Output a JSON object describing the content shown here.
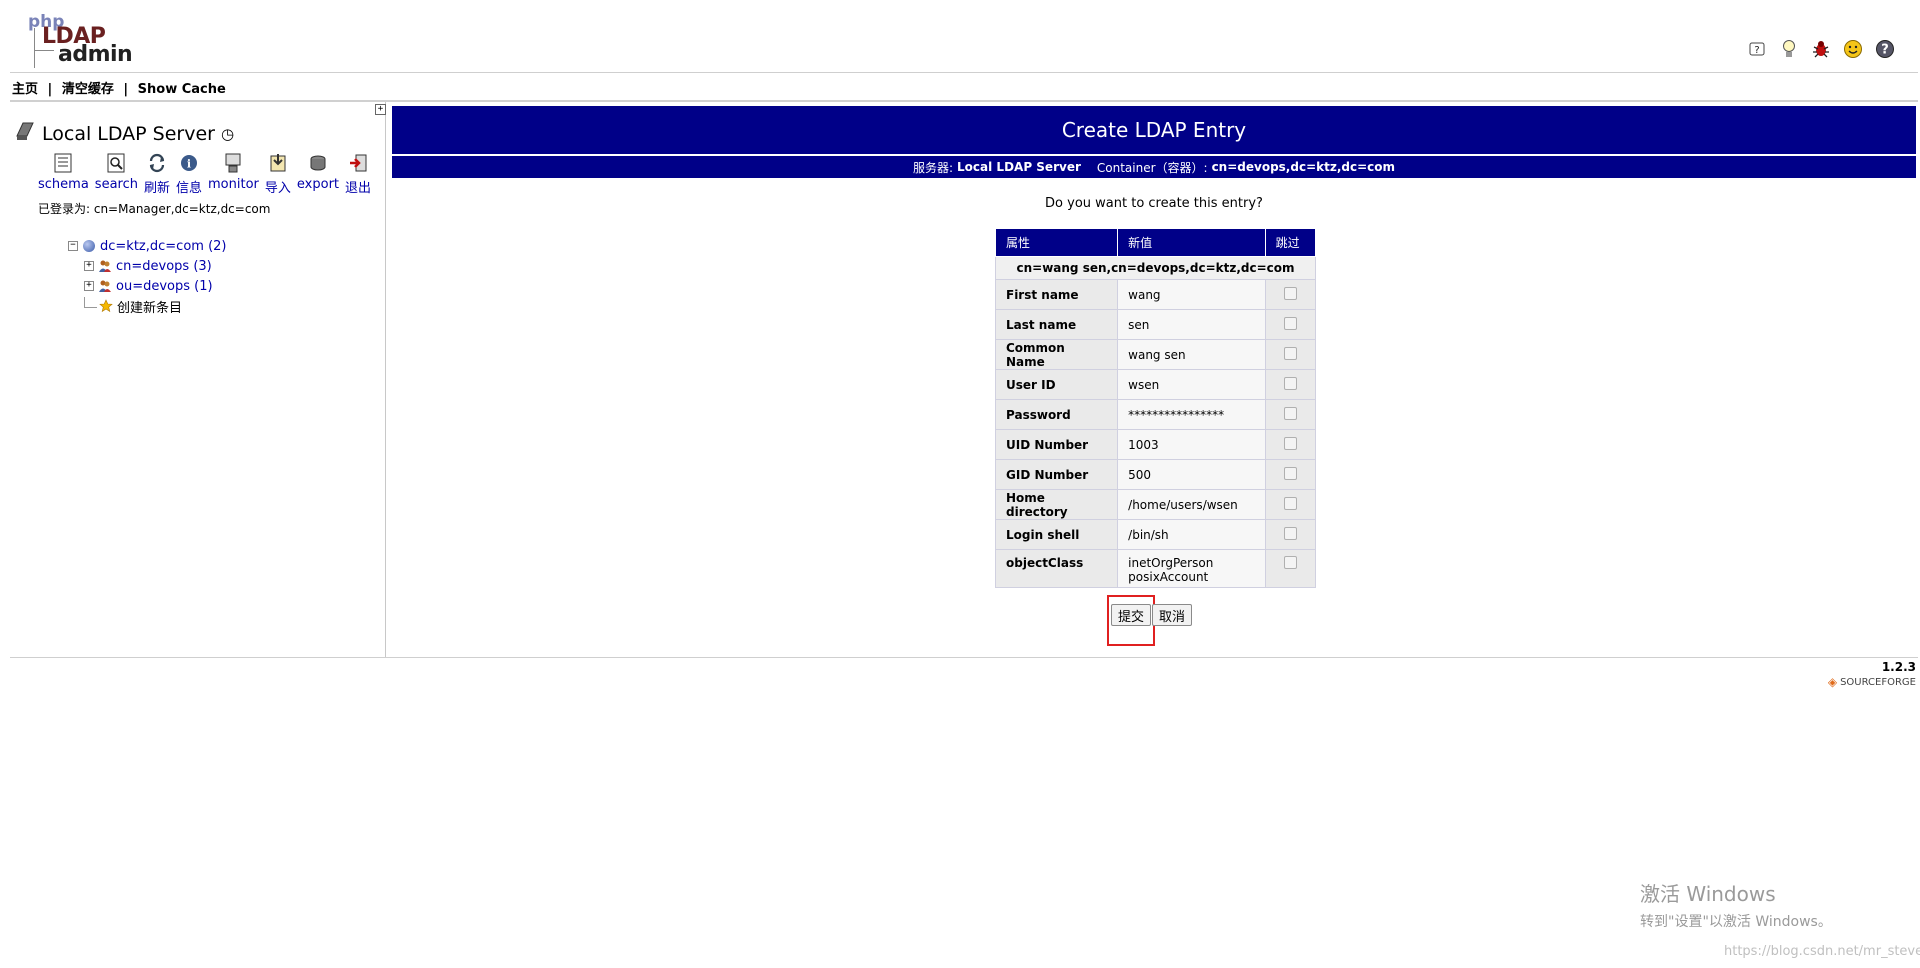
{
  "header": {
    "logo": {
      "php": "php",
      "ldap": "LDAP",
      "admin": "admin"
    },
    "icons": [
      "help-icon",
      "lightbulb-icon",
      "bug-icon",
      "smiley-icon",
      "question-circle-icon"
    ]
  },
  "topnav": {
    "home": "主页",
    "purge": "清空缓存",
    "show_cache": "Show Cache",
    "separator": "|"
  },
  "left": {
    "toggle": "+",
    "server_name": "Local LDAP Server",
    "clock_glyph": "◷",
    "toolbar": [
      {
        "label": "schema",
        "icon": "schema-icon"
      },
      {
        "label": "search",
        "icon": "search-icon"
      },
      {
        "label": "刷新",
        "icon": "refresh-icon"
      },
      {
        "label": "信息",
        "icon": "info-icon"
      },
      {
        "label": "monitor",
        "icon": "monitor-icon"
      },
      {
        "label": "导入",
        "icon": "import-icon"
      },
      {
        "label": "export",
        "icon": "export-icon"
      },
      {
        "label": "退出",
        "icon": "logout-icon"
      }
    ],
    "login_as": "已登录为: cn=Manager,dc=ktz,dc=com",
    "tree": {
      "root": {
        "label": "dc=ktz,dc=com (2)",
        "toggle": "−"
      },
      "children": [
        {
          "label": "cn=devops (3)",
          "toggle": "+"
        },
        {
          "label": "ou=devops (1)",
          "toggle": "+"
        }
      ],
      "create": "创建新条目"
    }
  },
  "main": {
    "title": "Create LDAP Entry",
    "subtitle": {
      "server_label": "服务器:",
      "server": "Local LDAP Server",
      "container_label": "Container（容器）:",
      "container": "cn=devops,dc=ktz,dc=com"
    },
    "question": "Do you want to create this entry?",
    "table": {
      "headers": [
        "属性",
        "新值",
        "跳过"
      ],
      "dn": "cn=wang sen,cn=devops,dc=ktz,dc=com",
      "rows": [
        {
          "attr": "First name",
          "value": "wang"
        },
        {
          "attr": "Last name",
          "value": "sen"
        },
        {
          "attr": "Common Name",
          "value": "wang sen"
        },
        {
          "attr": "User ID",
          "value": "wsen"
        },
        {
          "attr": "Password",
          "value": "****************"
        },
        {
          "attr": "UID Number",
          "value": "1003"
        },
        {
          "attr": "GID Number",
          "value": "500"
        },
        {
          "attr": "Home directory",
          "value": "/home/users/wsen"
        },
        {
          "attr": "Login shell",
          "value": "/bin/sh"
        },
        {
          "attr": "objectClass",
          "value_line1": "inetOrgPerson",
          "value_line2": "posixAccount"
        }
      ]
    },
    "buttons": {
      "submit": "提交",
      "cancel": "取消"
    }
  },
  "footer": {
    "version": "1.2.3",
    "sourceforge": "SOURCEFORGE"
  },
  "watermark": {
    "activate_title": "激活 Windows",
    "activate_sub": "转到\"设置\"以激活 Windows。",
    "csdn": "https://blog.csdn.net/mr_steve"
  }
}
